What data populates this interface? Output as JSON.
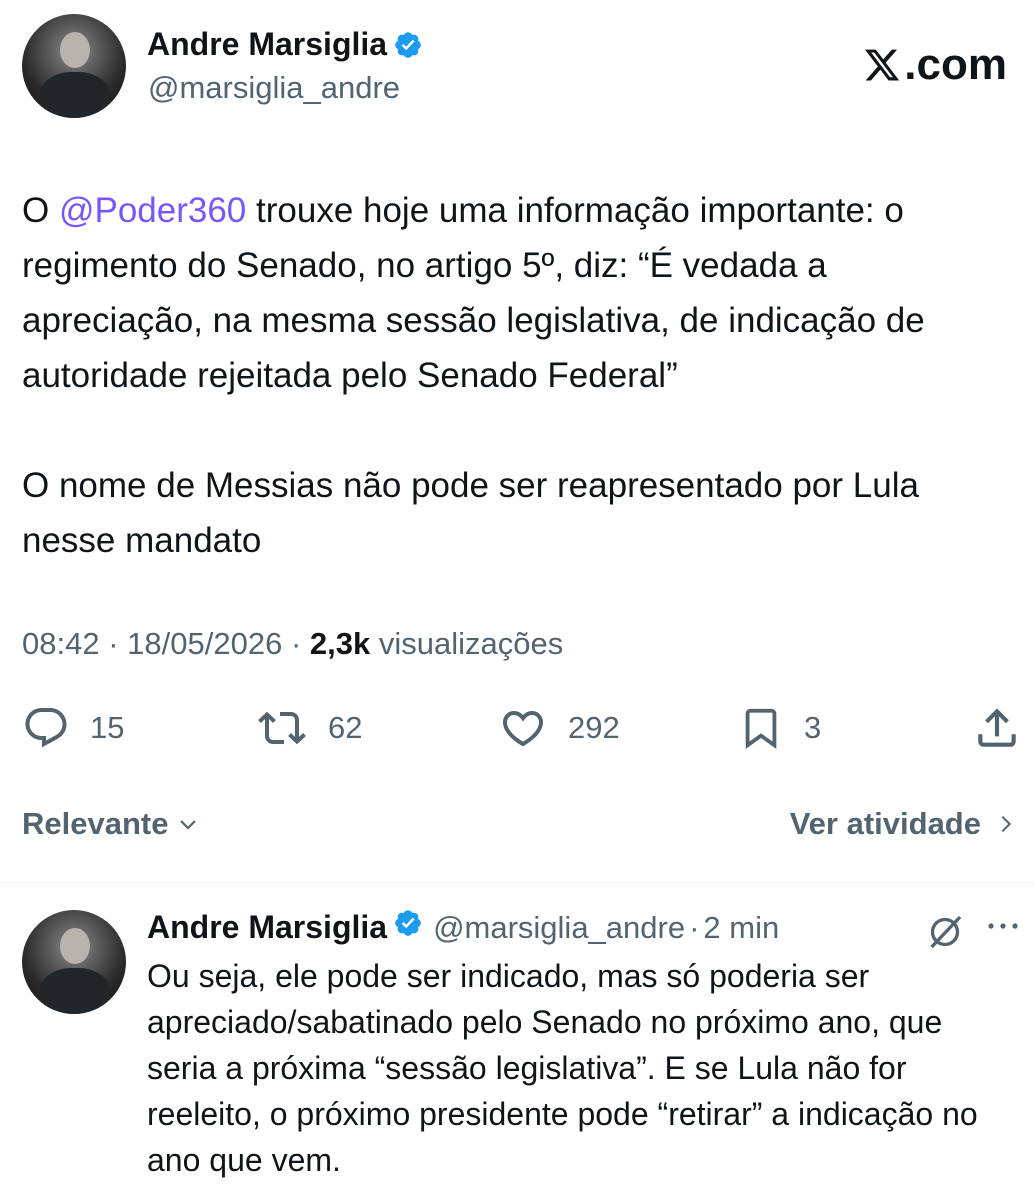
{
  "tweet": {
    "author_name": "Andre Marsiglia",
    "author_handle": "@marsiglia_andre",
    "brand": ".com",
    "text_prefix": "O ",
    "mention": "@Poder360",
    "text_p1_rest": " trouxe hoje uma informação importante: o regimento do Senado, no artigo 5º, diz: “É vedada a apreciação, na mesma sessão legislativa, de indicação de autoridade rejeitada pelo Senado Federal”",
    "text_p2": "O nome de Messias não pode ser reapresentado por Lula nesse mandato",
    "time": "08:42",
    "date": "18/05/2026",
    "views_count": "2,3k",
    "views_label": "visualizações",
    "separator": "·"
  },
  "actions": {
    "replies": "15",
    "retweets": "62",
    "likes": "292",
    "bookmarks": "3"
  },
  "sort": {
    "label": "Relevante",
    "activity_label": "Ver atividade"
  },
  "reply": {
    "author_name": "Andre Marsiglia",
    "author_handle": "@marsiglia_andre",
    "separator": "·",
    "time": "2 min",
    "text": "Ou seja, ele pode ser indicado, mas só poderia ser apreciado/sabatinado pelo Senado no próximo ano, que seria a próxima “sessão legislativa”. E se Lula não for reeleito, o próximo presidente pode “retirar” a indicação no ano que vem."
  },
  "colors": {
    "verified_blue": "#1d9bf0",
    "mention_purple": "#7856ff",
    "secondary_text": "#536471",
    "primary_text": "#0f1419"
  },
  "icons": [
    "verified-badge-icon",
    "x-logo-icon",
    "reply-icon",
    "retweet-icon",
    "like-icon",
    "bookmark-icon",
    "share-icon",
    "chevron-down-icon",
    "chevron-right-icon",
    "grok-icon",
    "more-icon"
  ]
}
